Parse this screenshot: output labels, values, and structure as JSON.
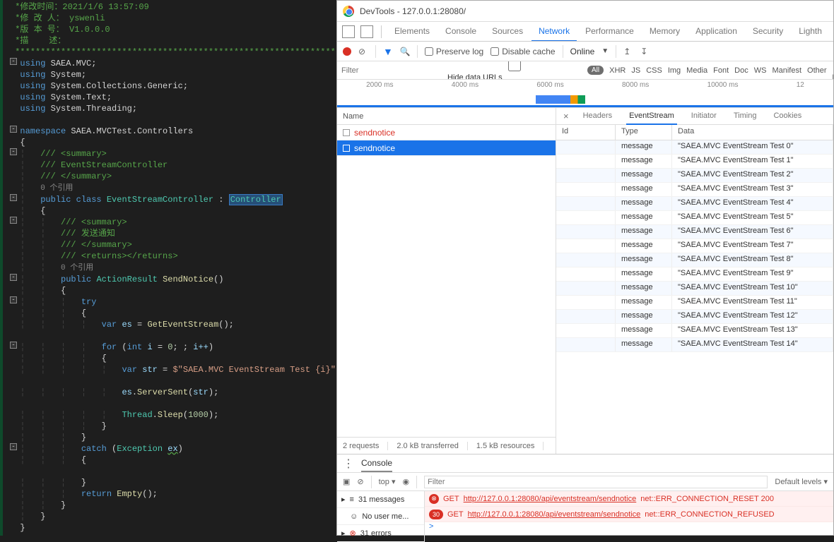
{
  "editor": {
    "comments": {
      "modTime": " *修改时间：2021/1/6 13:57:09",
      "author": " *修 改 人： yswenli",
      "version": " *版 本 号： V1.0.0.0",
      "desc": " *描    述：",
      "stars": " *****************************************************************************/"
    },
    "usings": [
      "SAEA.MVC",
      "System",
      "System.Collections.Generic",
      "System.Text",
      "System.Threading"
    ],
    "namespace": "SAEA.MVCTest.Controllers",
    "summary1a": "/// <summary>",
    "summary1b": "/// EventStreamController",
    "summary1c": "/// </summary>",
    "refs": "0 个引用",
    "classDecl": {
      "kw": "public class",
      "name": "EventStreamController",
      "colon": " : ",
      "base": "Controller"
    },
    "summary2a": "/// <summary>",
    "summary2b": "/// 发送通知",
    "summary2c": "/// </summary>",
    "summary2d": "/// <returns></returns>",
    "method": {
      "kw": "public",
      "ret": "ActionResult",
      "name": "SendNotice"
    },
    "tryKw": "try",
    "line_es": {
      "v": "var",
      "n": "es",
      "call": "GetEventStream"
    },
    "line_for": {
      "kw": "for",
      "iv": "int",
      "i": "i",
      "zero": "0",
      "pp": "i++"
    },
    "line_str": {
      "v": "var",
      "n": "str",
      "tpl": "$\"SAEA.MVC EventStream Test {i}\";"
    },
    "line_sent": {
      "obj": "es",
      "m": "ServerSent",
      "arg": "str"
    },
    "line_sleep": {
      "cls": "Thread",
      "m": "Sleep",
      "arg": "1000"
    },
    "catchKw": "catch",
    "exType": "Exception",
    "exVar": "ex",
    "returnKw": "return",
    "empty": "Empty"
  },
  "devtools": {
    "title": "DevTools - 127.0.0.1:28080/",
    "tabs": [
      "Elements",
      "Console",
      "Sources",
      "Network",
      "Performance",
      "Memory",
      "Application",
      "Security",
      "Lighth"
    ],
    "activeTab": "Network",
    "toolbar": {
      "preserve": "Preserve log",
      "disable": "Disable cache",
      "online": "Online"
    },
    "filter": {
      "placeholder": "Filter",
      "hide": "Hide data URLs",
      "all": "All",
      "types": [
        "XHR",
        "JS",
        "CSS",
        "Img",
        "Media",
        "Font",
        "Doc",
        "WS",
        "Manifest",
        "Other"
      ],
      "has": "Has"
    },
    "timeline": [
      "2000 ms",
      "4000 ms",
      "6000 ms",
      "8000 ms",
      "10000 ms",
      "12"
    ],
    "requests": {
      "header": "Name",
      "items": [
        {
          "name": "sendnotice",
          "red": true,
          "sel": false
        },
        {
          "name": "sendnotice",
          "red": false,
          "sel": true
        }
      ],
      "footer": {
        "count": "2 requests",
        "xfer": "2.0 kB transferred",
        "res": "1.5 kB resources"
      }
    },
    "detail": {
      "tabs": [
        "Headers",
        "EventStream",
        "Initiator",
        "Timing",
        "Cookies"
      ],
      "active": "EventStream",
      "cols": {
        "id": "Id",
        "type": "Type",
        "data": "Data"
      },
      "rows": [
        {
          "type": "message",
          "data": "\"SAEA.MVC EventStream Test 0\""
        },
        {
          "type": "message",
          "data": "\"SAEA.MVC EventStream Test 1\""
        },
        {
          "type": "message",
          "data": "\"SAEA.MVC EventStream Test 2\""
        },
        {
          "type": "message",
          "data": "\"SAEA.MVC EventStream Test 3\""
        },
        {
          "type": "message",
          "data": "\"SAEA.MVC EventStream Test 4\""
        },
        {
          "type": "message",
          "data": "\"SAEA.MVC EventStream Test 5\""
        },
        {
          "type": "message",
          "data": "\"SAEA.MVC EventStream Test 6\""
        },
        {
          "type": "message",
          "data": "\"SAEA.MVC EventStream Test 7\""
        },
        {
          "type": "message",
          "data": "\"SAEA.MVC EventStream Test 8\""
        },
        {
          "type": "message",
          "data": "\"SAEA.MVC EventStream Test 9\""
        },
        {
          "type": "message",
          "data": "\"SAEA.MVC EventStream Test 10\""
        },
        {
          "type": "message",
          "data": "\"SAEA.MVC EventStream Test 11\""
        },
        {
          "type": "message",
          "data": "\"SAEA.MVC EventStream Test 12\""
        },
        {
          "type": "message",
          "data": "\"SAEA.MVC EventStream Test 13\""
        },
        {
          "type": "message",
          "data": "\"SAEA.MVC EventStream Test 14\""
        }
      ]
    },
    "console": {
      "tab": "Console",
      "top": "top",
      "filterPh": "Filter",
      "levels": "Default levels",
      "sidebar": [
        {
          "icon": "≡",
          "txt": "31 messages"
        },
        {
          "icon": "☺",
          "txt": "No user me..."
        },
        {
          "icon": "⊗",
          "txt": "31 errors"
        }
      ],
      "errors": [
        {
          "badge": "⊗",
          "method": "GET",
          "url": "http://127.0.0.1:28080/api/eventstream/sendnotice",
          "tail": " net::ERR_CONNECTION_RESET 200"
        },
        {
          "badge": "30",
          "method": "GET",
          "url": "http://127.0.0.1:28080/api/eventstream/sendnotice",
          "tail": " net::ERR_CONNECTION_REFUSED"
        }
      ],
      "prompt": ">"
    }
  }
}
